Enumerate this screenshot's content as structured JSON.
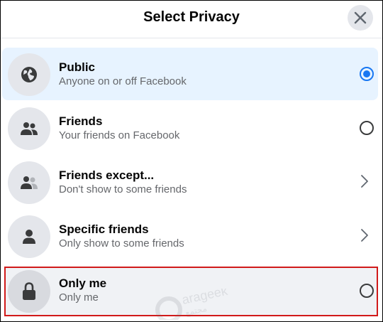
{
  "dialog": {
    "title": "Select Privacy",
    "close_icon": "close-icon"
  },
  "options": [
    {
      "label": "Public",
      "sub": "Anyone on or off Facebook",
      "icon": "globe-icon",
      "control": "radio",
      "selected": true
    },
    {
      "label": "Friends",
      "sub": "Your friends on Facebook",
      "icon": "friends-icon",
      "control": "radio",
      "selected": false
    },
    {
      "label": "Friends except...",
      "sub": "Don't show to some friends",
      "icon": "friends-except-icon",
      "control": "chevron",
      "selected": false
    },
    {
      "label": "Specific friends",
      "sub": "Only show to some friends",
      "icon": "person-icon",
      "control": "chevron",
      "selected": false
    },
    {
      "label": "Only me",
      "sub": "Only me",
      "icon": "lock-icon",
      "control": "radio",
      "selected": false,
      "highlighted": true
    }
  ],
  "colors": {
    "accent": "#1877f2",
    "selected_bg": "#e7f3ff",
    "highlight_border": "#d11a1a"
  }
}
